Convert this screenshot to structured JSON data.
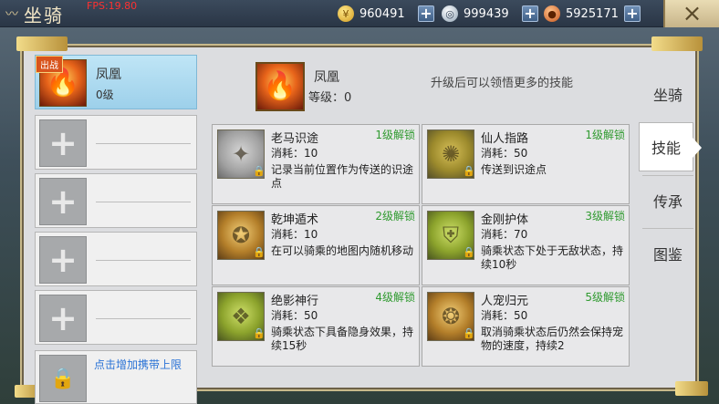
{
  "topbar": {
    "title": "坐骑",
    "title_icon": "wing-ornament-icon",
    "fps": "FPS:19.80",
    "currencies": [
      {
        "name": "gold",
        "value": "960491",
        "icon": "gold-ingot-icon"
      },
      {
        "name": "silver",
        "value": "999439",
        "icon": "silver-coin-icon"
      },
      {
        "name": "copper",
        "value": "5925171",
        "icon": "copper-coin-icon"
      }
    ],
    "plus_label": "+",
    "close_label": "×"
  },
  "mount_list": {
    "selected": {
      "tag": "出战",
      "name": "凤凰",
      "level": "0级",
      "icon": "phoenix-icon"
    },
    "empty_slots": 4,
    "plus_glyph": "+",
    "lock_slot_text": "点击增加携带上限",
    "lock_glyph": "🔒"
  },
  "detail": {
    "name": "凤凰",
    "level_label": "等级：0",
    "hint": "升级后可以领悟更多的技能"
  },
  "skills": [
    {
      "name": "老马识途",
      "unlock": "1级解锁",
      "cost": "消耗：10",
      "desc": "记录当前位置作为传送的识途点",
      "icon": "horse-trail-icon"
    },
    {
      "name": "仙人指路",
      "unlock": "1级解锁",
      "cost": "消耗：50",
      "desc": "传送到识途点",
      "icon": "star-compass-icon"
    },
    {
      "name": "乾坤遁术",
      "unlock": "2级解锁",
      "cost": "消耗：10",
      "desc": "在可以骑乘的地图内随机移动",
      "icon": "pentagram-icon"
    },
    {
      "name": "金刚护体",
      "unlock": "3级解锁",
      "cost": "消耗：70",
      "desc": "骑乘状态下处于无敌状态，持续10秒",
      "icon": "shield-icon"
    },
    {
      "name": "绝影神行",
      "unlock": "4级解锁",
      "cost": "消耗：50",
      "desc": "骑乘状态下具备隐身效果，持续15秒",
      "icon": "shadow-wing-icon"
    },
    {
      "name": "人宠归元",
      "unlock": "5级解锁",
      "cost": "消耗：50",
      "desc": "取消骑乘状态后仍然会保持宠物的速度，持续2",
      "icon": "pet-unite-icon"
    }
  ],
  "tabs": [
    {
      "label": "坐骑",
      "active": false
    },
    {
      "label": "技能",
      "active": true
    },
    {
      "label": "传承",
      "active": false
    },
    {
      "label": "图鉴",
      "active": false
    }
  ],
  "colors": {
    "unlock_green": "#2f9a2f",
    "lock_text_blue": "#2b73d6",
    "selected_slot": "#bfe5f6",
    "fps_red": "#ff3030"
  }
}
